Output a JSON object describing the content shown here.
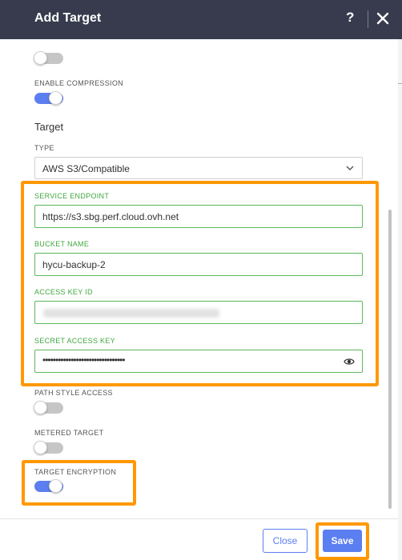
{
  "dialog": {
    "title": "Add Target",
    "help_label": "?",
    "close_icon": "close-icon"
  },
  "fields": {
    "enable_compression": {
      "label": "ENABLE COMPRESSION",
      "on": true
    },
    "section_title": "Target",
    "type": {
      "label": "TYPE",
      "value": "AWS S3/Compatible"
    },
    "service_endpoint": {
      "label": "SERVICE ENDPOINT",
      "value": "https://s3.sbg.perf.cloud.ovh.net"
    },
    "bucket_name": {
      "label": "BUCKET NAME",
      "value": "hycu-backup-2"
    },
    "access_key_id": {
      "label": "ACCESS KEY ID",
      "value": ""
    },
    "secret_access_key": {
      "label": "SECRET ACCESS KEY",
      "value": "••••••••••••••••••••••••••••••••"
    },
    "path_style_access": {
      "label": "PATH STYLE ACCESS",
      "on": false
    },
    "metered_target": {
      "label": "METERED TARGET",
      "on": false
    },
    "target_encryption": {
      "label": "TARGET ENCRYPTION",
      "on": true
    }
  },
  "footer": {
    "close_label": "Close",
    "save_label": "Save"
  },
  "colors": {
    "header_bg": "#373b4d",
    "accent": "#5b7ef0",
    "valid_green": "#5cb85c",
    "highlight": "#ff9800"
  }
}
